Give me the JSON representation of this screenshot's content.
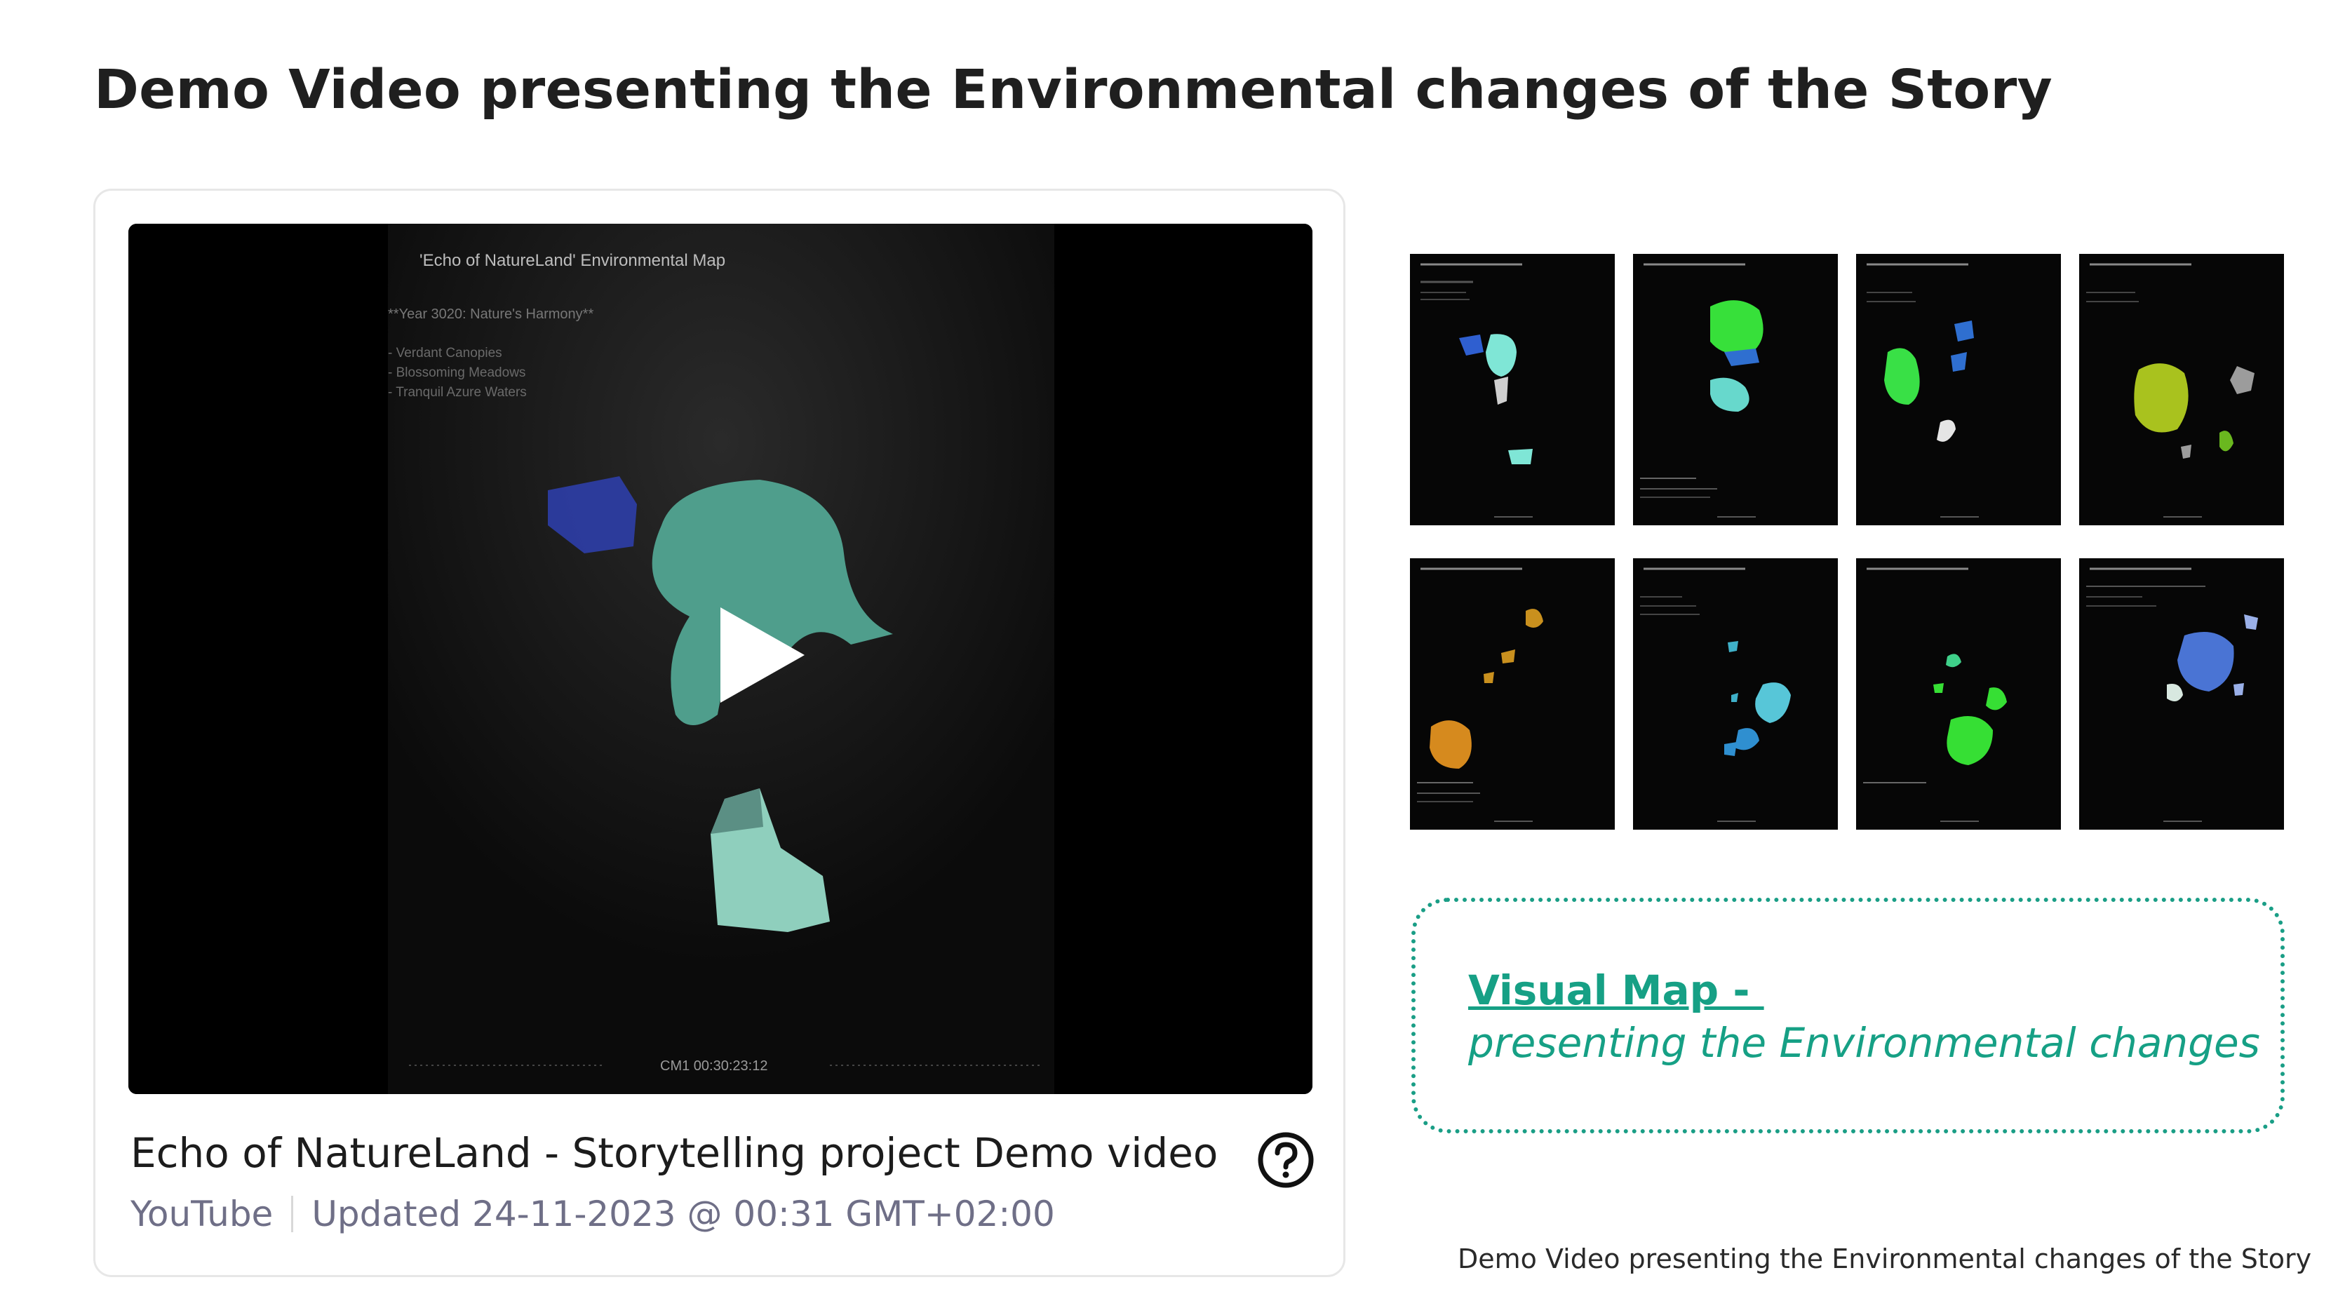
{
  "page_title": "Demo Video presenting the Environmental changes of the Story",
  "video": {
    "frame_title": "'Echo of NatureLand' Environmental Map",
    "frame_year": "**Year 3020: Nature's Harmony**",
    "frame_bullets": [
      "- Verdant Canopies",
      "- Blossoming Meadows",
      "- Tranquil Azure Waters"
    ],
    "frame_timecode": "CM1 00:30:23:12",
    "title": "Echo of NatureLand - Storytelling project Demo video",
    "source": "YouTube",
    "updated": "Updated 24-11-2023 @ 00:31 GMT+02:00",
    "play_icon": "play-icon",
    "help_icon": "question-circle-icon"
  },
  "thumbnails": [
    {
      "index": 1,
      "accent": "#7fe6d6"
    },
    {
      "index": 2,
      "accent": "#37e03a"
    },
    {
      "index": 3,
      "accent": "#39e046"
    },
    {
      "index": 4,
      "accent": "#a9c21e"
    },
    {
      "index": 5,
      "accent": "#d68a1e"
    },
    {
      "index": 6,
      "accent": "#3fb0c8"
    },
    {
      "index": 7,
      "accent": "#36df34"
    },
    {
      "index": 8,
      "accent": "#4a74d4"
    }
  ],
  "map_box": {
    "link_label": "Visual Map - ",
    "subtitle": "presenting the Environmental changes"
  },
  "caption": "Demo Video presenting the Environmental changes of the Story",
  "colors": {
    "accent": "#16a085",
    "meta_text": "#6f6f87",
    "card_border": "#e7e7e7"
  }
}
